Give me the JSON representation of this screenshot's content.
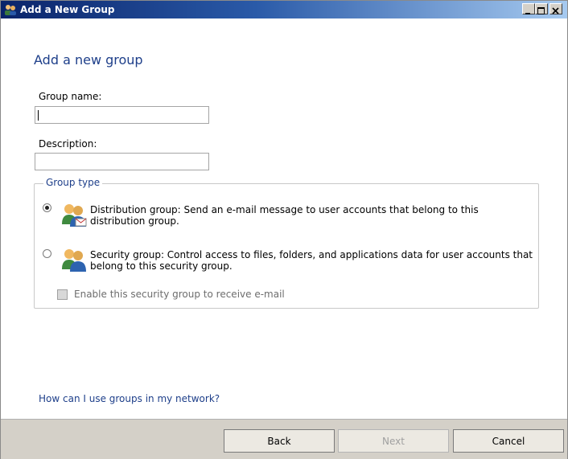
{
  "window": {
    "title": "Add a New Group"
  },
  "heading": "Add a new group",
  "group_name": {
    "label": "Group name:",
    "value": ""
  },
  "description": {
    "label": "Description:",
    "value": ""
  },
  "group_type": {
    "legend": "Group type",
    "distribution": {
      "line1": "Distribution group: Send an e-mail message to user accounts that belong to this",
      "line2": "distribution group.",
      "selected": true
    },
    "security": {
      "line1": "Security group: Control access to files, folders, and applications data for user accounts that",
      "line2": "belong to this security group.",
      "selected": false
    },
    "enable_email": {
      "label": "Enable this security group to receive e-mail",
      "checked": false,
      "enabled": false
    }
  },
  "help_link": "How can I use groups in my network?",
  "buttons": {
    "back": "Back",
    "next": "Next",
    "cancel": "Cancel"
  },
  "icons": {
    "title": "users-group-icon",
    "distribution": "group-mail-icon",
    "security": "group-security-icon"
  }
}
